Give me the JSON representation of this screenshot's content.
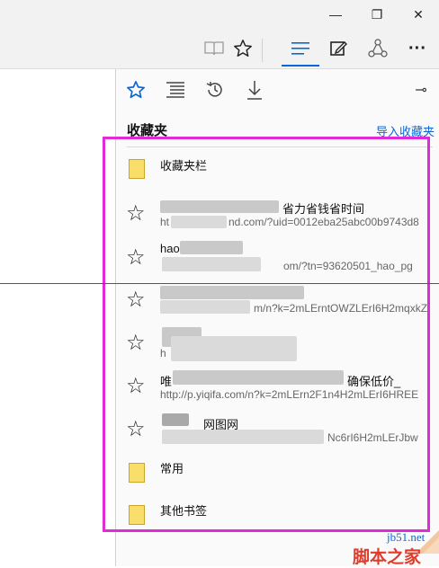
{
  "window": {
    "minimize_glyph": "—",
    "restore_glyph": "❐",
    "close_glyph": "✕"
  },
  "toolbar": {
    "icons": [
      "reading-view-icon",
      "add-favorite-icon",
      "hub-icon",
      "web-note-icon",
      "share-icon",
      "more-icon"
    ],
    "more_glyph": "···",
    "accent_color": "#0a67d8"
  },
  "hub": {
    "tabs": [
      "favorites-tab",
      "reading-list-tab",
      "history-tab",
      "downloads-tab"
    ],
    "pin_glyph": "⊸",
    "title": "收藏夹",
    "import_link": "导入收藏夹"
  },
  "favorites": {
    "folders": [
      {
        "title": "收藏夹栏"
      },
      {
        "title": "常用"
      },
      {
        "title": "其他书签"
      }
    ],
    "items": [
      {
        "title": "省力省钱省时间",
        "url": "ht",
        "url_tail": "nd.com/?uid=0012eba25abc00b9743d8"
      },
      {
        "title": "hao",
        "url": "",
        "url_tail": "om/?tn=93620501_hao_pg"
      },
      {
        "title": "",
        "url": "",
        "url_tail": "m/n?k=2mLErntOWZLErI6H2mqxkZ"
      },
      {
        "title": "",
        "url": "h",
        "url_tail": ""
      },
      {
        "title": "唯",
        "title_tail": "确保低价_",
        "url": "http://p.yiqifa.com/n?k=2mLErn2F1n4H2mLErI6HREE"
      },
      {
        "title": "网图网",
        "url": "",
        "url_tail": "Nc6rI6H2mLErJbw"
      }
    ]
  },
  "watermark": {
    "site": "jb51.net",
    "brand": "脚本之家"
  }
}
